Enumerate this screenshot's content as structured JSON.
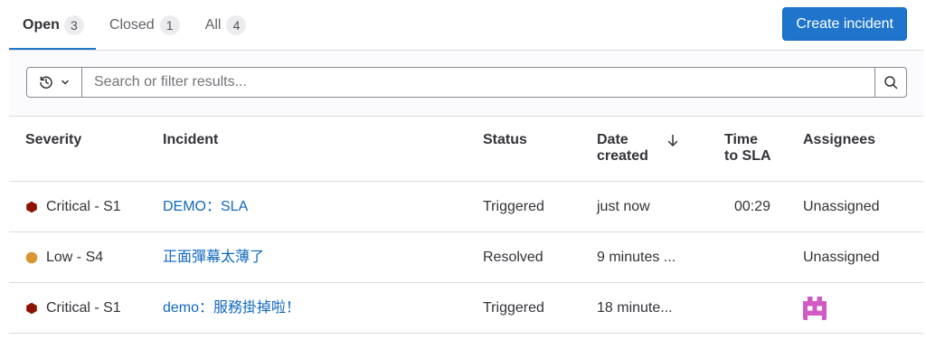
{
  "tabs": [
    {
      "label": "Open",
      "count": "3"
    },
    {
      "label": "Closed",
      "count": "1"
    },
    {
      "label": "All",
      "count": "4"
    }
  ],
  "actions": {
    "create_incident": "Create incident"
  },
  "filter": {
    "history_icon": "history-icon",
    "history_dropdown_icon": "chevron-down-icon",
    "placeholder": "Search or filter results...",
    "search_icon": "search-icon"
  },
  "table": {
    "columns": {
      "severity": "Severity",
      "incident": "Incident",
      "status": "Status",
      "date_created": "Date created",
      "time_to_sla": "Time to SLA",
      "assignees": "Assignees"
    },
    "sort_icon": "arrow-down-icon",
    "rows": [
      {
        "severity": "Critical - S1",
        "severity_icon": "severity-critical-icon",
        "incident": "DEMO：SLA",
        "status": "Triggered",
        "date_created": "just now",
        "time_to_sla": "00:29",
        "assignees": "Unassigned"
      },
      {
        "severity": "Low - S4",
        "severity_icon": "severity-low-icon",
        "incident": "正面彈幕太薄了",
        "status": "Resolved",
        "date_created": "9 minutes ...",
        "time_to_sla": "",
        "assignees": "Unassigned"
      },
      {
        "severity": "Critical - S1",
        "severity_icon": "severity-critical-icon",
        "incident": "demo：服務掛掉啦！",
        "status": "Triggered",
        "date_created": "18 minute...",
        "time_to_sla": "",
        "assignee_avatar": "avatar-icon"
      }
    ]
  },
  "colors": {
    "accent": "#1f75cb",
    "link": "#1068bf",
    "text": "#333238",
    "muted": "#626168",
    "severity_critical": "#8d1300",
    "severity_low": "#d99530",
    "avatar": "#d15bc4"
  }
}
